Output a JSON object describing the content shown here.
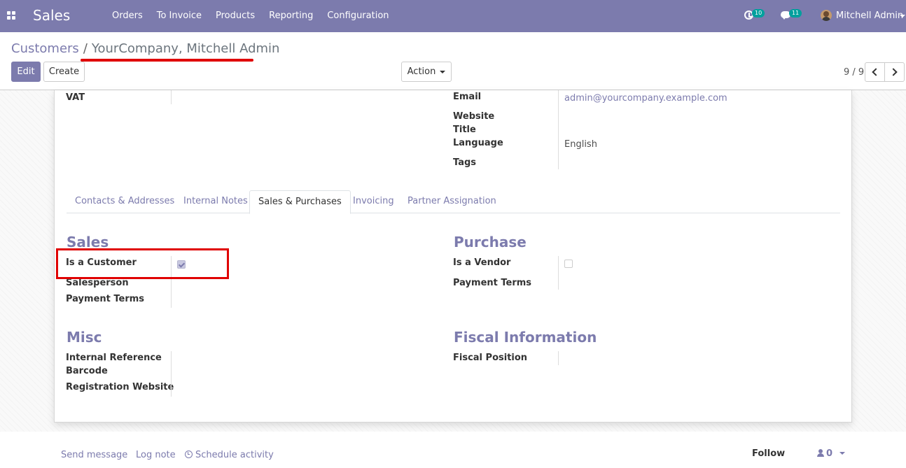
{
  "navbar": {
    "app_name": "Sales",
    "menu": [
      "Orders",
      "To Invoice",
      "Products",
      "Reporting",
      "Configuration"
    ],
    "activity_count": "10",
    "message_count": "11",
    "user_name": "Mitchell Admin",
    "background_color": "#7c7bad",
    "icons": [
      "apps-grid-icon",
      "activity-clock-icon",
      "chat-bubble-icon",
      "avatar"
    ]
  },
  "control_panel": {
    "breadcrumb_parent": "Customers",
    "breadcrumb_separator": "/",
    "breadcrumb_current": "YourCompany, Mitchell Admin",
    "edit_label": "Edit",
    "create_label": "Create",
    "action_label": "Action",
    "pager_value": "9 / 9"
  },
  "form": {
    "top_left": {
      "vat_label": "VAT",
      "vat_value": ""
    },
    "top_right": {
      "email_label": "Email",
      "email_value": "admin@yourcompany.example.com",
      "website_label": "Website",
      "title_label": "Title",
      "language_label": "Language",
      "language_value": "English",
      "tags_label": "Tags"
    },
    "tabs": [
      "Contacts & Addresses",
      "Internal Notes",
      "Sales & Purchases",
      "Invoicing",
      "Partner Assignation"
    ],
    "active_tab": "Sales & Purchases",
    "sales": {
      "title": "Sales",
      "is_customer_label": "Is a Customer",
      "is_customer_checked": true,
      "salesperson_label": "Salesperson",
      "payment_terms_label": "Payment Terms"
    },
    "purchase": {
      "title": "Purchase",
      "is_vendor_label": "Is a Vendor",
      "is_vendor_checked": false,
      "payment_terms_label": "Payment Terms"
    },
    "misc": {
      "title": "Misc",
      "internal_reference_label": "Internal Reference",
      "barcode_label": "Barcode",
      "registration_website_label": "Registration Website"
    },
    "fiscal": {
      "title": "Fiscal Information",
      "fiscal_position_label": "Fiscal Position"
    }
  },
  "chatter": {
    "send_message": "Send message",
    "log_note": "Log note",
    "schedule_activity": "Schedule activity",
    "follow": "Follow",
    "followers_count": "0"
  },
  "highlight_color": "#e00000"
}
